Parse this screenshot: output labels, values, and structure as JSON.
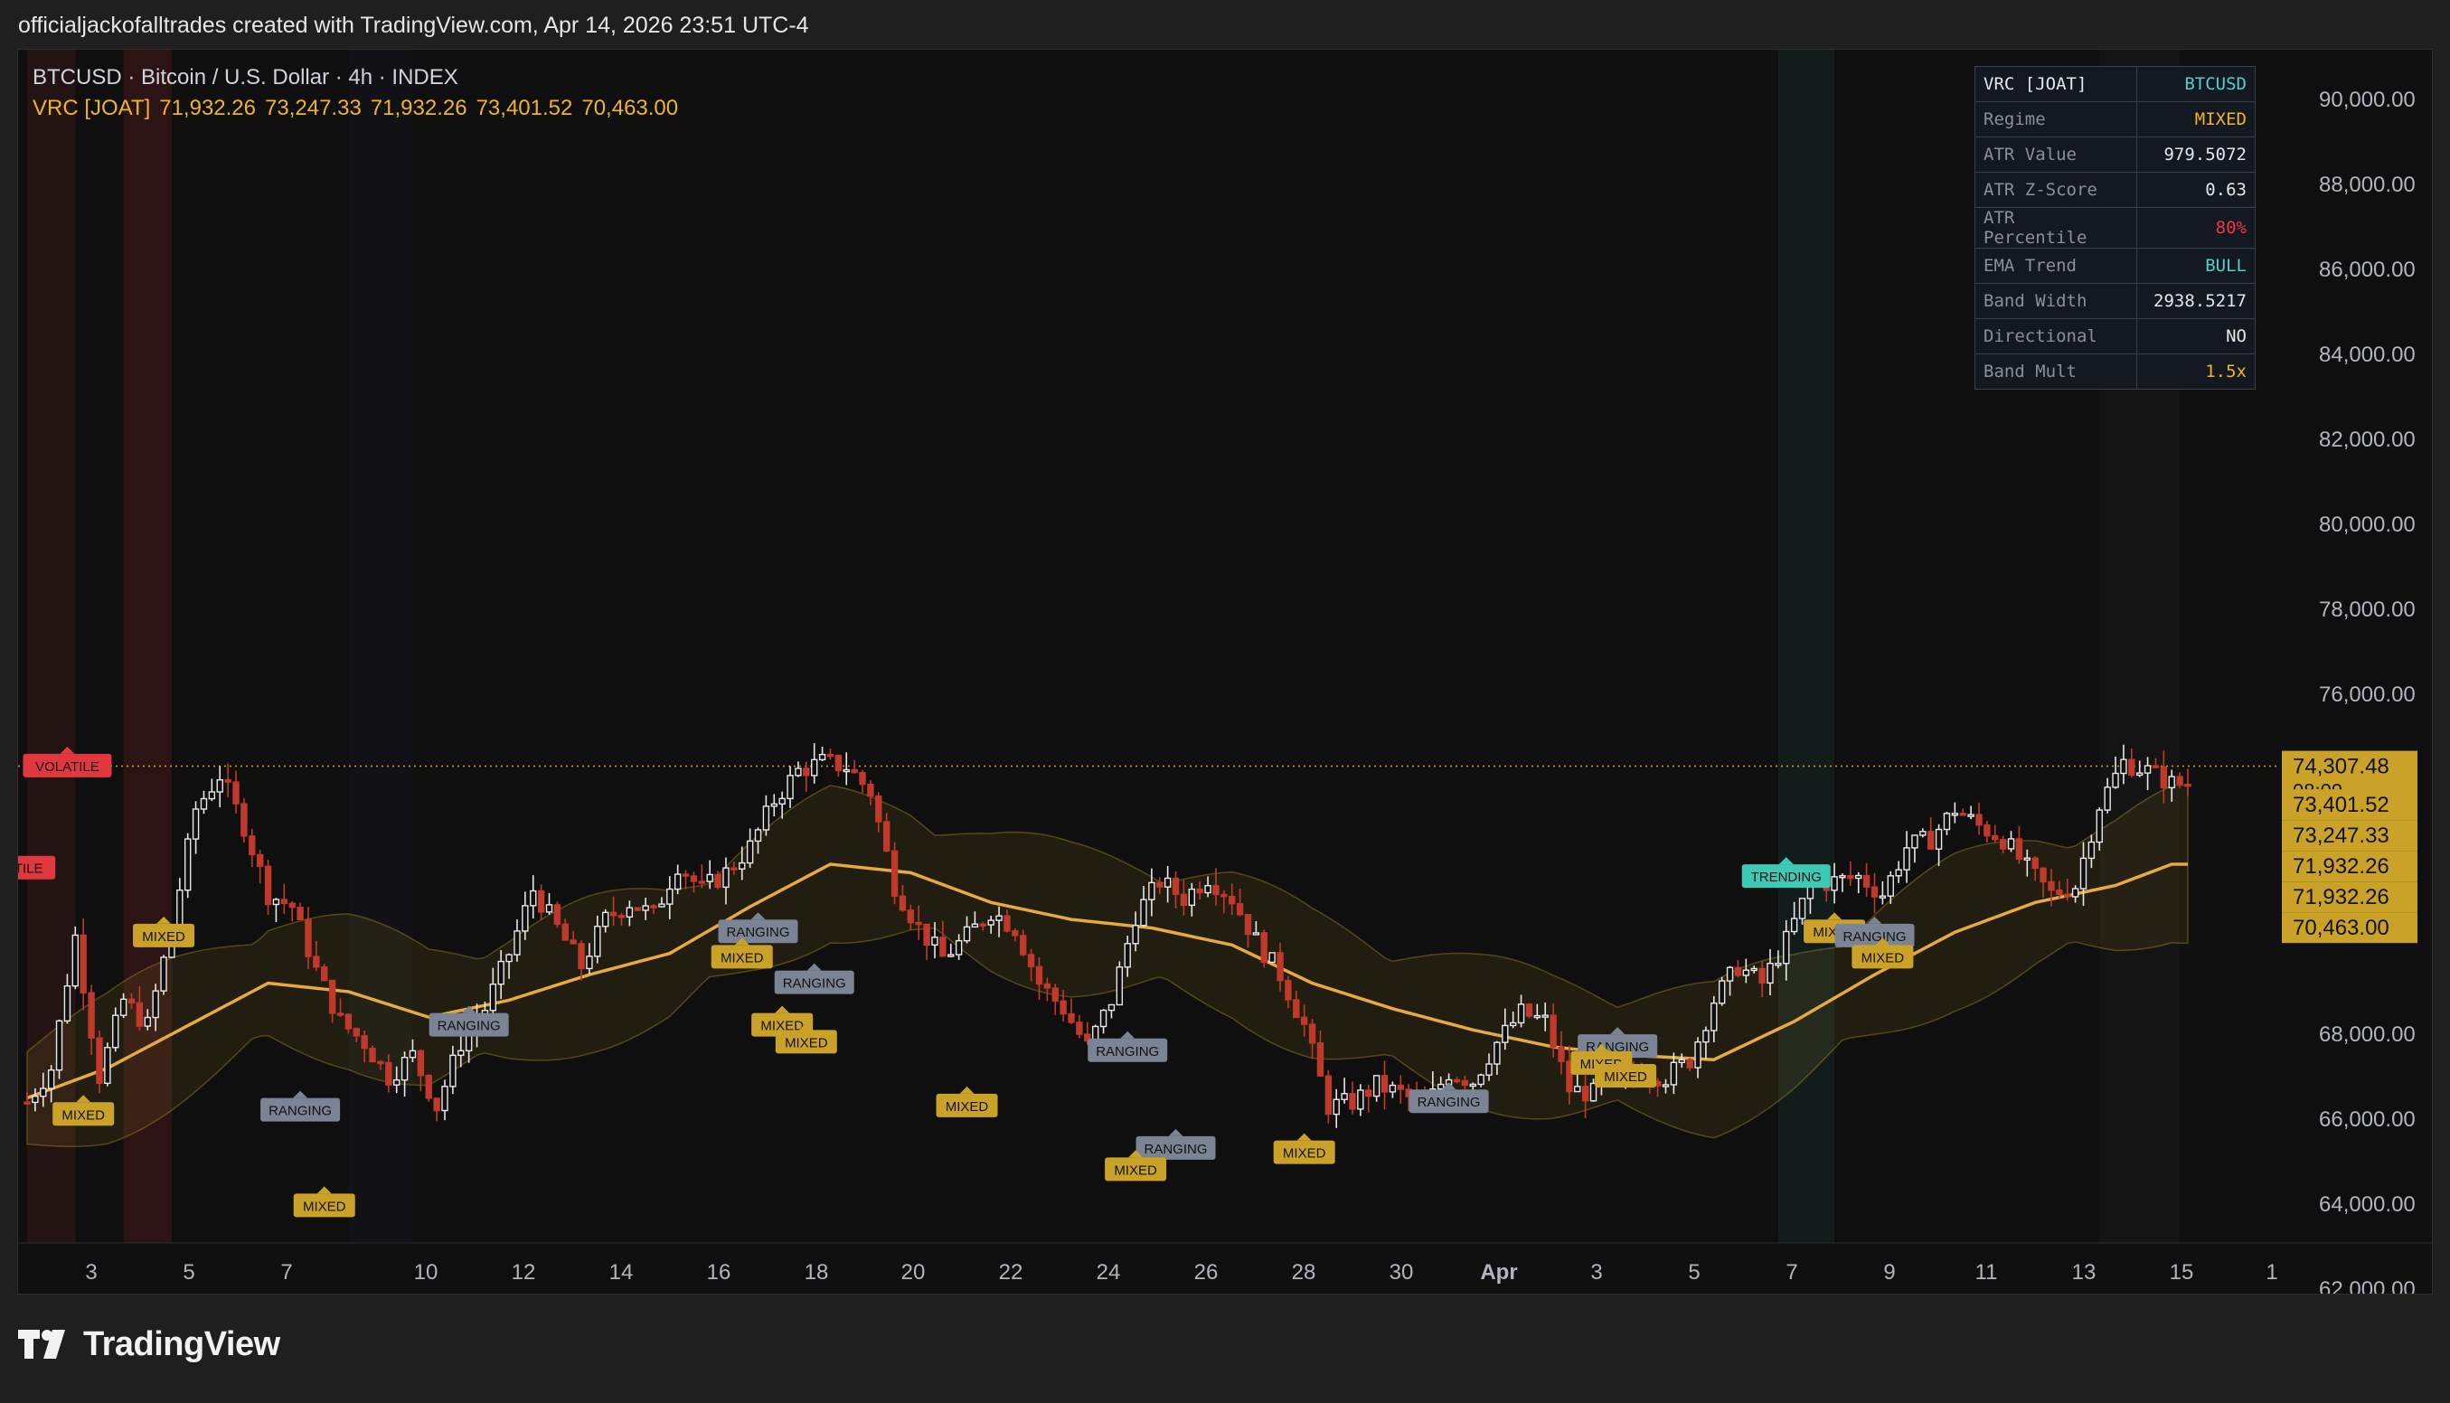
{
  "header": {
    "text": "officialjackofalltrades created with TradingView.com, Apr 14, 2026 23:51 UTC-4"
  },
  "legend": {
    "symbol": "BTCUSD · Bitcoin / U.S. Dollar · 4h · INDEX",
    "indicator": "VRC [JOAT]",
    "values": [
      "71,932.26",
      "73,247.33",
      "71,932.26",
      "73,401.52",
      "70,463.00"
    ]
  },
  "info_table": {
    "header_key": "VRC [JOAT]",
    "header_value": "BTCUSD",
    "rows": [
      {
        "key": "Regime",
        "value": "MIXED",
        "color": "#f0b429"
      },
      {
        "key": "ATR Value",
        "value": "979.5072",
        "color": "#e6e6e6"
      },
      {
        "key": "ATR Z-Score",
        "value": "0.63",
        "color": "#e6e6e6"
      },
      {
        "key": "ATR Percentile",
        "value": "80%",
        "color": "#f23645"
      },
      {
        "key": "EMA Trend",
        "value": "BULL",
        "color": "#4fd1c5"
      },
      {
        "key": "Band Width",
        "value": "2938.5217",
        "color": "#e6e6e6"
      },
      {
        "key": "Directional",
        "value": "NO",
        "color": "#e6e6e6"
      },
      {
        "key": "Band Mult",
        "value": "1.5x",
        "color": "#f0b429"
      }
    ]
  },
  "footer": {
    "brand": "TradingView"
  },
  "colors": {
    "up": "#e8e8e8",
    "down": "#c0392b",
    "mixed": "#c9a227",
    "ranging": "#7b8494",
    "volatile": "#e0383e",
    "trending": "#3ec9b4",
    "ema": "#e8a93d"
  },
  "chart_data": {
    "type": "candlestick",
    "ylim": [
      62000,
      90000
    ],
    "y_ticks": [
      "90,000.00",
      "88,000.00",
      "86,000.00",
      "84,000.00",
      "82,000.00",
      "80,000.00",
      "78,000.00",
      "76,000.00",
      "68,000.00",
      "66,000.00",
      "64,000.00",
      "62,000.00"
    ],
    "x_ticks": [
      "3",
      "5",
      "7",
      "10",
      "12",
      "14",
      "16",
      "18",
      "20",
      "22",
      "24",
      "26",
      "28",
      "30",
      "Apr",
      "3",
      "5",
      "7",
      "9",
      "11",
      "13",
      "15",
      "1"
    ],
    "price_labels": [
      {
        "value": 74307.48,
        "text": "74,307.48",
        "sub": "08:09"
      },
      {
        "value": 73401.52,
        "text": "73,401.52"
      },
      {
        "value": 73247.33,
        "text": "73,247.33"
      },
      {
        "value": 71932.26,
        "text": "71,932.26"
      },
      {
        "value": 71932.26,
        "text": "71,932.26"
      },
      {
        "value": 70463.0,
        "text": "70,463.00"
      }
    ],
    "current_price": 74307.48,
    "close_path": [
      [
        0,
        66400
      ],
      [
        3,
        67200
      ],
      [
        6,
        70300
      ],
      [
        9,
        67000
      ],
      [
        12,
        68800
      ],
      [
        15,
        68200
      ],
      [
        18,
        70500
      ],
      [
        21,
        73300
      ],
      [
        24,
        74100
      ],
      [
        27,
        72900
      ],
      [
        30,
        71300
      ],
      [
        33,
        71000
      ],
      [
        36,
        69500
      ],
      [
        39,
        68300
      ],
      [
        42,
        67800
      ],
      [
        45,
        67000
      ],
      [
        48,
        67500
      ],
      [
        51,
        66300
      ],
      [
        54,
        67800
      ],
      [
        57,
        68600
      ],
      [
        60,
        69900
      ],
      [
        63,
        71400
      ],
      [
        66,
        70500
      ],
      [
        69,
        69600
      ],
      [
        72,
        70700
      ],
      [
        75,
        71100
      ],
      [
        78,
        70800
      ],
      [
        81,
        72000
      ],
      [
        84,
        71400
      ],
      [
        87,
        71800
      ],
      [
        90,
        72400
      ],
      [
        93,
        73500
      ],
      [
        96,
        74200
      ],
      [
        99,
        74400
      ],
      [
        102,
        74300
      ],
      [
        105,
        73700
      ],
      [
        108,
        71500
      ],
      [
        111,
        70500
      ],
      [
        114,
        69800
      ],
      [
        117,
        70300
      ],
      [
        120,
        70900
      ],
      [
        123,
        70500
      ],
      [
        126,
        69200
      ],
      [
        129,
        68600
      ],
      [
        132,
        67700
      ],
      [
        135,
        68800
      ],
      [
        138,
        70800
      ],
      [
        141,
        71600
      ],
      [
        144,
        71200
      ],
      [
        147,
        71700
      ],
      [
        150,
        71200
      ],
      [
        153,
        70200
      ],
      [
        156,
        69400
      ],
      [
        159,
        68200
      ],
      [
        162,
        66300
      ],
      [
        165,
        66400
      ],
      [
        168,
        66800
      ],
      [
        171,
        66600
      ],
      [
        174,
        66300
      ],
      [
        177,
        67100
      ],
      [
        180,
        66900
      ],
      [
        183,
        67800
      ],
      [
        186,
        68500
      ],
      [
        189,
        68300
      ],
      [
        192,
        66700
      ],
      [
        195,
        66600
      ],
      [
        198,
        66900
      ],
      [
        201,
        67100
      ],
      [
        204,
        67000
      ],
      [
        207,
        67400
      ],
      [
        210,
        68800
      ],
      [
        213,
        69600
      ],
      [
        216,
        69200
      ],
      [
        219,
        70200
      ],
      [
        222,
        71500
      ],
      [
        225,
        71600
      ],
      [
        228,
        71700
      ],
      [
        231,
        71300
      ],
      [
        234,
        72400
      ],
      [
        237,
        72600
      ],
      [
        240,
        73300
      ],
      [
        243,
        72900
      ],
      [
        246,
        72600
      ],
      [
        249,
        71900
      ],
      [
        252,
        71300
      ],
      [
        255,
        71500
      ],
      [
        258,
        73400
      ],
      [
        261,
        74400
      ],
      [
        264,
        74200
      ],
      [
        267,
        73900
      ]
    ],
    "ema_path": [
      [
        0,
        66500
      ],
      [
        10,
        67200
      ],
      [
        20,
        68200
      ],
      [
        30,
        69200
      ],
      [
        40,
        69000
      ],
      [
        50,
        68400
      ],
      [
        60,
        68800
      ],
      [
        70,
        69400
      ],
      [
        80,
        69900
      ],
      [
        90,
        71000
      ],
      [
        100,
        72000
      ],
      [
        110,
        71800
      ],
      [
        120,
        71100
      ],
      [
        130,
        70700
      ],
      [
        140,
        70500
      ],
      [
        150,
        70100
      ],
      [
        160,
        69200
      ],
      [
        170,
        68600
      ],
      [
        180,
        68100
      ],
      [
        190,
        67700
      ],
      [
        200,
        67500
      ],
      [
        210,
        67400
      ],
      [
        220,
        68300
      ],
      [
        230,
        69400
      ],
      [
        240,
        70400
      ],
      [
        250,
        71100
      ],
      [
        260,
        71500
      ],
      [
        267,
        72000
      ]
    ],
    "band_halfwidth": 1550,
    "regime_labels": [
      {
        "text": "VOLATILE",
        "i": 5,
        "price": 74300,
        "color": "volatile"
      },
      {
        "text": "VOLATILE",
        "i": -2,
        "price": 71900,
        "color": "volatile"
      },
      {
        "text": "MIXED",
        "i": 17,
        "price": 70300,
        "color": "mixed"
      },
      {
        "text": "MIXED",
        "i": 7,
        "price": 66100,
        "color": "mixed"
      },
      {
        "text": "RANGING",
        "i": 55,
        "price": 68200,
        "color": "ranging"
      },
      {
        "text": "RANGING",
        "i": 34,
        "price": 66200,
        "color": "ranging"
      },
      {
        "text": "MIXED",
        "i": 37,
        "price": 63950,
        "color": "mixed"
      },
      {
        "text": "RANGING",
        "i": 91,
        "price": 70400,
        "color": "ranging"
      },
      {
        "text": "MIXED",
        "i": 89,
        "price": 69800,
        "color": "mixed"
      },
      {
        "text": "RANGING",
        "i": 98,
        "price": 69200,
        "color": "ranging"
      },
      {
        "text": "MIXED",
        "i": 94,
        "price": 68200,
        "color": "mixed"
      },
      {
        "text": "MIXED",
        "i": 97,
        "price": 67800,
        "color": "mixed"
      },
      {
        "text": "MIXED",
        "i": 117,
        "price": 66300,
        "color": "mixed"
      },
      {
        "text": "RANGING",
        "i": 137,
        "price": 67600,
        "color": "ranging"
      },
      {
        "text": "RANGING",
        "i": 143,
        "price": 65300,
        "color": "ranging"
      },
      {
        "text": "MIXED",
        "i": 138,
        "price": 64800,
        "color": "mixed"
      },
      {
        "text": "MIXED",
        "i": 159,
        "price": 65200,
        "color": "mixed"
      },
      {
        "text": "RANGING",
        "i": 177,
        "price": 66400,
        "color": "ranging"
      },
      {
        "text": "RANGING",
        "i": 198,
        "price": 67700,
        "color": "ranging"
      },
      {
        "text": "MIXED",
        "i": 196,
        "price": 67300,
        "color": "mixed"
      },
      {
        "text": "MIXED",
        "i": 199,
        "price": 67000,
        "color": "mixed"
      },
      {
        "text": "TRENDING",
        "i": 219,
        "price": 71700,
        "color": "trending"
      },
      {
        "text": "MIXED",
        "i": 225,
        "price": 70400,
        "color": "mixed"
      },
      {
        "text": "RANGING",
        "i": 230,
        "price": 70300,
        "color": "ranging"
      },
      {
        "text": "MIXED",
        "i": 231,
        "price": 69800,
        "color": "mixed"
      }
    ]
  }
}
